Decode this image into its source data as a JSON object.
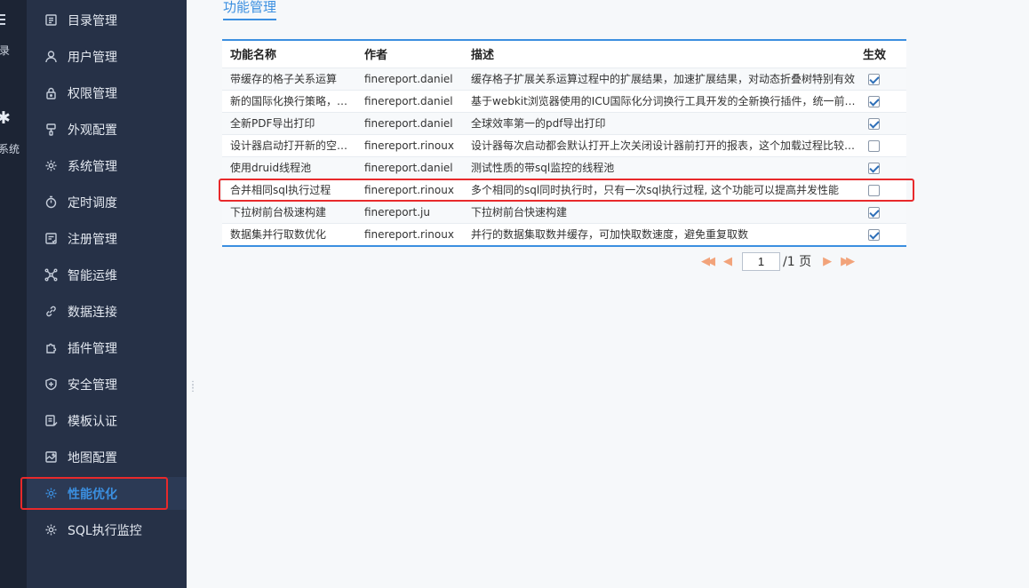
{
  "rail": {
    "label_top": "录",
    "label_bottom": "系统"
  },
  "sidebar": {
    "items": [
      {
        "label": "目录管理",
        "icon": "folder-list-icon"
      },
      {
        "label": "用户管理",
        "icon": "user-icon"
      },
      {
        "label": "权限管理",
        "icon": "lock-icon"
      },
      {
        "label": "外观配置",
        "icon": "brush-icon"
      },
      {
        "label": "系统管理",
        "icon": "gear-icon"
      },
      {
        "label": "定时调度",
        "icon": "timer-icon"
      },
      {
        "label": "注册管理",
        "icon": "register-icon"
      },
      {
        "label": "智能运维",
        "icon": "network-icon"
      },
      {
        "label": "数据连接",
        "icon": "link-icon"
      },
      {
        "label": "插件管理",
        "icon": "plugin-icon"
      },
      {
        "label": "安全管理",
        "icon": "shield-icon"
      },
      {
        "label": "模板认证",
        "icon": "template-icon"
      },
      {
        "label": "地图配置",
        "icon": "map-icon"
      },
      {
        "label": "性能优化",
        "icon": "gear-icon",
        "active": true
      },
      {
        "label": "SQL执行监控",
        "icon": "gear-icon"
      }
    ]
  },
  "main": {
    "title": "功能管理",
    "table": {
      "headers": [
        "功能名称",
        "作者",
        "描述",
        "生效"
      ],
      "rows": [
        {
          "name": "带缓存的格子关系运算",
          "author": "finereport.daniel",
          "desc": "缓存格子扩展关系运算过程中的扩展结果，加速扩展结果，对动态折叠树特别有效",
          "enabled": true
        },
        {
          "name": "新的国际化换行策略，测...",
          "author": "finereport.daniel",
          "desc": "基于webkit浏览器使用的ICU国际化分词换行工具开发的全新换行插件，统一前后台...",
          "enabled": true
        },
        {
          "name": "全新PDF导出打印",
          "author": "finereport.daniel",
          "desc": "全球效率第一的pdf导出打印",
          "enabled": true
        },
        {
          "name": "设计器启动打开新的空报表",
          "author": "finereport.rinoux",
          "desc": "设计器每次启动都会默认打开上次关闭设计器前打开的报表，这个加载过程比较耗...",
          "enabled": false
        },
        {
          "name": "使用druid线程池",
          "author": "finereport.daniel",
          "desc": "测试性质的带sql监控的线程池",
          "enabled": true
        },
        {
          "name": "合并相同sql执行过程",
          "author": "finereport.rinoux",
          "desc": "多个相同的sql同时执行时，只有一次sql执行过程, 这个功能可以提高并发性能",
          "enabled": false
        },
        {
          "name": "下拉树前台极速构建",
          "author": "finereport.ju",
          "desc": "下拉树前台快速构建",
          "enabled": true
        },
        {
          "name": "数据集并行取数优化",
          "author": "finereport.rinoux",
          "desc": "并行的数据集取数并缓存，可加快取数速度，避免重复取数",
          "enabled": true
        }
      ]
    },
    "pager": {
      "current": "1",
      "total_label": "/1 页"
    }
  },
  "colors": {
    "accent": "#3b8fe0",
    "highlight": "#e8292b",
    "sidebar_bg": "#263147",
    "pager_arrow": "#f2a37a"
  }
}
